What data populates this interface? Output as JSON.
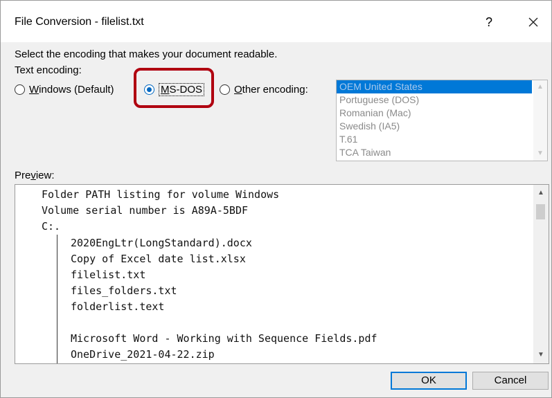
{
  "window": {
    "title": "File Conversion - filelist.txt",
    "help": "?"
  },
  "instruction": "Select the encoding that makes your document readable.",
  "encoding_label": "Text encoding:",
  "radios": [
    {
      "prefix": "",
      "key": "W",
      "rest": "indows (Default)",
      "checked": false
    },
    {
      "prefix": "",
      "key": "M",
      "rest": "S-DOS",
      "checked": true
    },
    {
      "prefix": "",
      "key": "O",
      "rest": "ther encoding:",
      "checked": false
    }
  ],
  "encodings": [
    "OEM United States",
    "Portuguese (DOS)",
    "Romanian (Mac)",
    "Swedish (IA5)",
    "T.61",
    "TCA Taiwan"
  ],
  "preview": {
    "label_pre": "Pre",
    "label_key": "v",
    "label_post": "iew:",
    "lines": [
      "Folder PATH listing for volume Windows",
      "Volume serial number is A89A-5BDF",
      "C:.",
      "2020EngLtr(LongStandard).docx",
      "Copy of Excel date list.xlsx",
      "filelist.txt",
      "files_folders.txt",
      "folderlist.text",
      "Microsoft Word - Working with Sequence Fields.pdf",
      "OneDrive_2021-04-22.zip"
    ]
  },
  "buttons": {
    "ok": "OK",
    "cancel": "Cancel"
  }
}
